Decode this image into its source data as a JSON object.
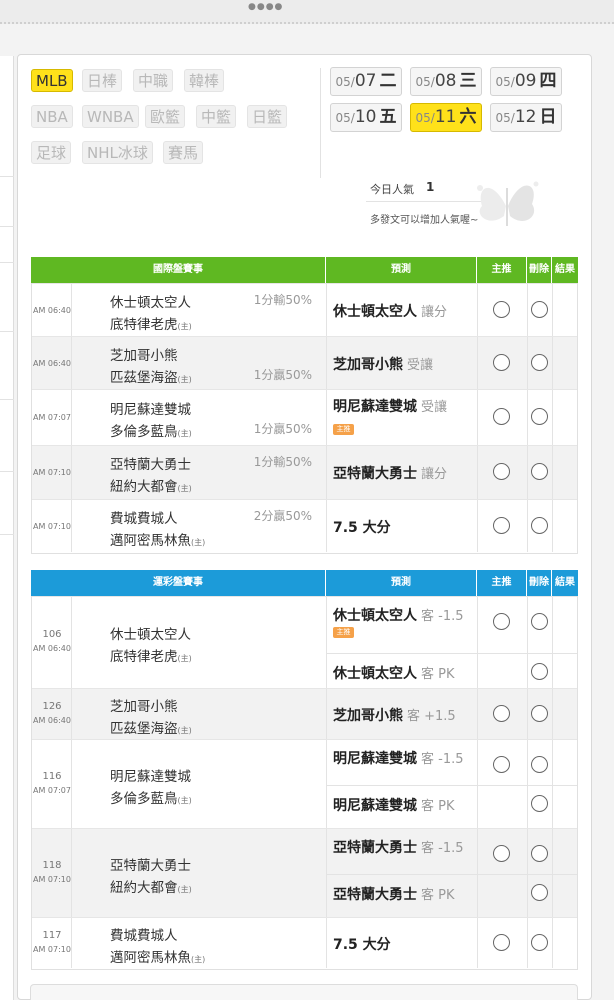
{
  "top_indicator": "●●●●",
  "sports_tabs": [
    {
      "label": "MLB",
      "active": true
    },
    {
      "label": "日棒",
      "active": false
    },
    {
      "label": "中職",
      "active": false
    },
    {
      "label": "韓棒",
      "active": false
    },
    {
      "label": "NBA",
      "active": false
    },
    {
      "label": "WNBA",
      "active": false
    },
    {
      "label": "歐籃",
      "active": false
    },
    {
      "label": "中籃",
      "active": false
    },
    {
      "label": "日籃",
      "active": false
    },
    {
      "label": "足球",
      "active": false
    },
    {
      "label": "NHL冰球",
      "active": false
    },
    {
      "label": "賽馬",
      "active": false
    }
  ],
  "dates": [
    {
      "month": "05/",
      "day": "07",
      "weekday": "二",
      "active": false
    },
    {
      "month": "05/",
      "day": "08",
      "weekday": "三",
      "active": false
    },
    {
      "month": "05/",
      "day": "09",
      "weekday": "四",
      "active": false
    },
    {
      "month": "05/",
      "day": "10",
      "weekday": "五",
      "active": false
    },
    {
      "month": "05/",
      "day": "11",
      "weekday": "六",
      "active": true
    },
    {
      "month": "05/",
      "day": "12",
      "weekday": "日",
      "active": false
    }
  ],
  "popularity": {
    "label": "今日人氣",
    "value": "1",
    "tip": "多發文可以增加人氣喔~"
  },
  "host_mark": "(主)",
  "badge_text": "主推",
  "intl_section": {
    "headers": {
      "game": "國際盤賽事",
      "pick": "預測",
      "main": "主推",
      "del": "刪除",
      "result": "結果"
    },
    "rows": [
      {
        "time": "AM 06:40",
        "away": "休士頓太空人",
        "home": "底特律老虎",
        "odds": "1分輸50%",
        "odds_line": 1,
        "pick": "休士頓太空人",
        "pick_type": "讓分",
        "badge": false
      },
      {
        "time": "AM 06:40",
        "away": "芝加哥小熊",
        "home": "匹茲堡海盜",
        "odds": "1分贏50%",
        "odds_line": 2,
        "pick": "芝加哥小熊",
        "pick_type": "受讓",
        "badge": false
      },
      {
        "time": "AM 07:07",
        "away": "明尼蘇達雙城",
        "home": "多倫多藍鳥",
        "odds": "1分贏50%",
        "odds_line": 2,
        "pick": "明尼蘇達雙城",
        "pick_type": "受讓",
        "badge": true
      },
      {
        "time": "AM 07:10",
        "away": "亞特蘭大勇士",
        "home": "紐約大都會",
        "odds": "1分輸50%",
        "odds_line": 1,
        "pick": "亞特蘭大勇士",
        "pick_type": "讓分",
        "badge": false
      },
      {
        "time": "AM 07:10",
        "away": "費城費城人",
        "home": "邁阿密馬林魚",
        "odds": "2分贏50%",
        "odds_line": 1,
        "pick": "7.5 大分",
        "pick_type": "",
        "badge": false
      }
    ]
  },
  "sport_lottery_section": {
    "headers": {
      "game": "運彩盤賽事",
      "pick": "預測",
      "main": "主推",
      "del": "刪除",
      "result": "結果"
    },
    "rows": [
      {
        "num": "106",
        "time": "AM 06:40",
        "away": "休士頓太空人",
        "home": "底特律老虎",
        "picks": [
          {
            "team": "休士頓太空人",
            "type": "客 -1.5",
            "badge": true
          },
          {
            "team": "休士頓太空人",
            "type": "客 PK",
            "badge": false
          }
        ]
      },
      {
        "num": "126",
        "time": "AM 06:40",
        "away": "芝加哥小熊",
        "home": "匹茲堡海盜",
        "picks": [
          {
            "team": "芝加哥小熊",
            "type": "客 +1.5",
            "badge": false
          }
        ]
      },
      {
        "num": "116",
        "time": "AM 07:07",
        "away": "明尼蘇達雙城",
        "home": "多倫多藍鳥",
        "picks": [
          {
            "team": "明尼蘇達雙城",
            "type": "客 -1.5",
            "badge": false
          },
          {
            "team": "明尼蘇達雙城",
            "type": "客 PK",
            "badge": false
          }
        ]
      },
      {
        "num": "118",
        "time": "AM 07:10",
        "away": "亞特蘭大勇士",
        "home": "紐約大都會",
        "picks": [
          {
            "team": "亞特蘭大勇士",
            "type": "客 -1.5",
            "badge": false
          },
          {
            "team": "亞特蘭大勇士",
            "type": "客 PK",
            "badge": false
          }
        ]
      },
      {
        "num": "117",
        "time": "AM 07:10",
        "away": "費城費城人",
        "home": "邁阿密馬林魚",
        "picks": [
          {
            "team": "7.5 大分",
            "type": "",
            "badge": false
          }
        ]
      }
    ]
  }
}
